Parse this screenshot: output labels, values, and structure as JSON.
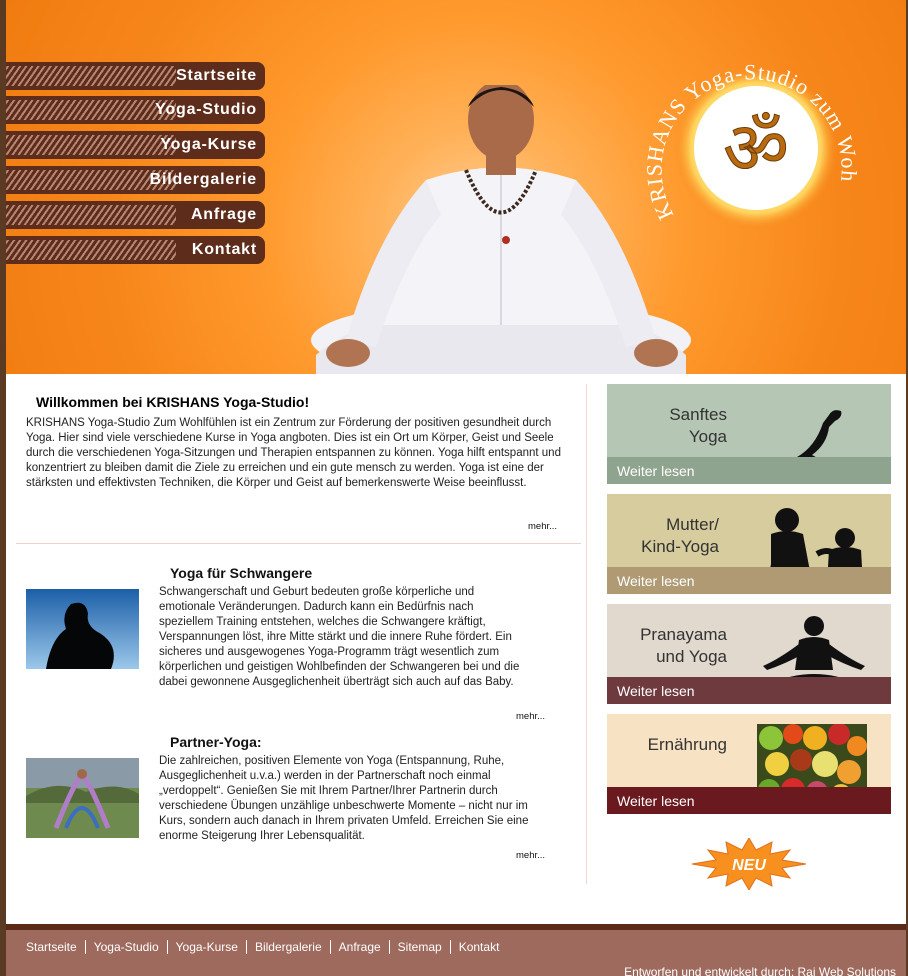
{
  "nav": {
    "items": [
      {
        "label": "Startseite"
      },
      {
        "label": "Yoga-Studio"
      },
      {
        "label": "Yoga-Kurse"
      },
      {
        "label": "Bildergalerie"
      },
      {
        "label": "Anfrage"
      },
      {
        "label": "Kontakt"
      }
    ]
  },
  "logo": {
    "ring_text": "KRISHANS Yoga-Studio zum Wohlfühlen",
    "symbol": "ॐ"
  },
  "welcome": {
    "title": "Willkommen bei KRISHANS Yoga-Studio!",
    "text": "KRISHANS Yoga-Studio Zum Wohlfühlen ist ein Zentrum zur Förderung der positiven gesundheit durch Yoga. Hier sind viele verschiedene Kurse in Yoga angboten. Dies ist ein Ort um Körper, Geist und Seele durch die verschiedenen Yoga-Sitzungen und Therapien entspannen zu können. Yoga hilft entspannt und konzentriert zu bleiben damit die Ziele zu erreichen und ein gute mensch zu werden. Yoga ist eine der stärksten und effektivsten Techniken, die Körper und Geist auf bemerkenswerte Weise beeinflusst.",
    "more": "mehr..."
  },
  "sections": [
    {
      "title": "Yoga für Schwangere",
      "text": "Schwangerschaft und Geburt bedeuten große körperliche und emotionale Veränderungen. Dadurch kann ein Bedürfnis nach speziellem Training entstehen, welches die Schwangere kräftigt, Verspannungen löst, ihre Mitte stärkt und die innere Ruhe fördert. Ein sicheres und ausgewogenes Yoga-Programm trägt wesentlich zum körperlichen und geistigen Wohlbefinden der Schwangeren bei und die dabei gewonnene Ausgeglichenheit überträgt sich auch auf das Baby.",
      "more": "mehr..."
    },
    {
      "title": "Partner-Yoga:",
      "text": "Die zahlreichen, positiven Elemente von Yoga (Entspannung, Ruhe, Ausgeglichenheit u.v.a.) werden in der Partnerschaft noch einmal „verdoppelt“. Genießen Sie mit Ihrem Partner/Ihrer Partnerin durch verschiedene Übungen unzählige unbeschwerte Momente – nicht nur im Kurs, sondern auch danach in Ihrem privaten Umfeld. Erreichen Sie eine enorme Steigerung Ihrer Lebensqualität.",
      "more": "mehr..."
    }
  ],
  "side_boxes": [
    {
      "title_line1": "Sanftes",
      "title_line2": "Yoga",
      "more": "Weiter lesen",
      "bg": "#b6c6b4",
      "bar": "#8fa48e"
    },
    {
      "title_line1": "Mutter/",
      "title_line2": "Kind-Yoga",
      "more": "Weiter lesen",
      "bg": "#d6cc9e",
      "bar": "#b09a74"
    },
    {
      "title_line1": "Pranayama",
      "title_line2": "und Yoga",
      "more": "Weiter lesen",
      "bg": "#e1d8ce",
      "bar": "#6e3a3e"
    },
    {
      "title_line1": "Ernährung",
      "title_line2": "",
      "more": "Weiter lesen",
      "bg": "#f7e2c4",
      "bar": "#6a1a1e"
    }
  ],
  "badge": {
    "label": "NEU"
  },
  "footer": {
    "links": [
      "Startseite",
      "Yoga-Studio",
      "Yoga-Kurse",
      "Bildergalerie",
      "Anfrage",
      "Sitemap",
      "Kontakt"
    ],
    "credit_prefix": "Entworfen und entwickelt durch:",
    "credit_link": "Raj Web Solutions"
  },
  "colors": {
    "header_orange": "#f7861a",
    "nav_brown": "#5e2c1a",
    "footer_bg": "#9e6a5e"
  }
}
